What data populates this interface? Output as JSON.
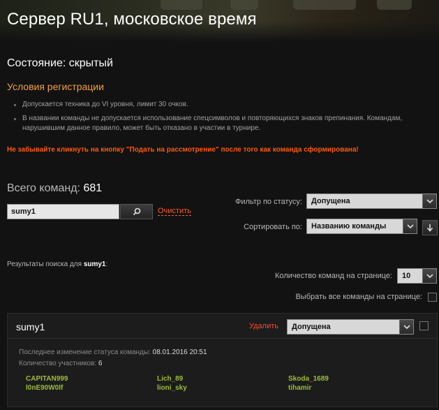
{
  "page": {
    "title": "Сервер RU1, московское время"
  },
  "state": {
    "text": "Состояние: скрытый"
  },
  "rules": {
    "title": "Условия регистрации",
    "items": [
      "Допускается техника до VI уровня, лимит 30 очков.",
      "В названии команды не допускается использование спецсимволов и повторяющихся знаков препинания. Командам, нарушившим данное правило, может быть отказано в участии в турнире."
    ],
    "warning": "Не забывайте кликнуть на кнопку \"Подать на рассмотрение\" после того как команда сформирована!"
  },
  "totals": {
    "label": "Всего команд:",
    "count": "681"
  },
  "search": {
    "value": "sumy1",
    "button_icon": "search-icon",
    "clear_label": "Очистить"
  },
  "filters": {
    "status_label": "Фильтр по статусу:",
    "status_value": "Допущена",
    "sort_label": "Сортировать по:",
    "sort_value": "Названию команды",
    "sort_direction_icon": "arrow-down-icon"
  },
  "results": {
    "prefix": "Результаты поиска для",
    "query": "sumy1",
    "suffix": ":"
  },
  "paging": {
    "per_page_label": "Количество команд на странице:",
    "per_page_value": "10",
    "select_all_label": "Выбрать все команды на странице:"
  },
  "team": {
    "name": "sumy1",
    "delete_label": "Удалить",
    "status_value": "Допущена",
    "last_change_label": "Последнее изменение статуса команды:",
    "last_change_value": "08.01.2016 20:51",
    "members_count_label": "Количество участников:",
    "members_count_value": "6",
    "members": [
      "CAPITAN999",
      "Lich_89",
      "Skoda_1689",
      "l0nE90W0lf",
      "lioni_sky",
      "tihamir"
    ]
  },
  "colors": {
    "accent_orange": "#f2a03d",
    "warning_red": "#ff5a0a",
    "member_green": "#9bbd3a"
  }
}
